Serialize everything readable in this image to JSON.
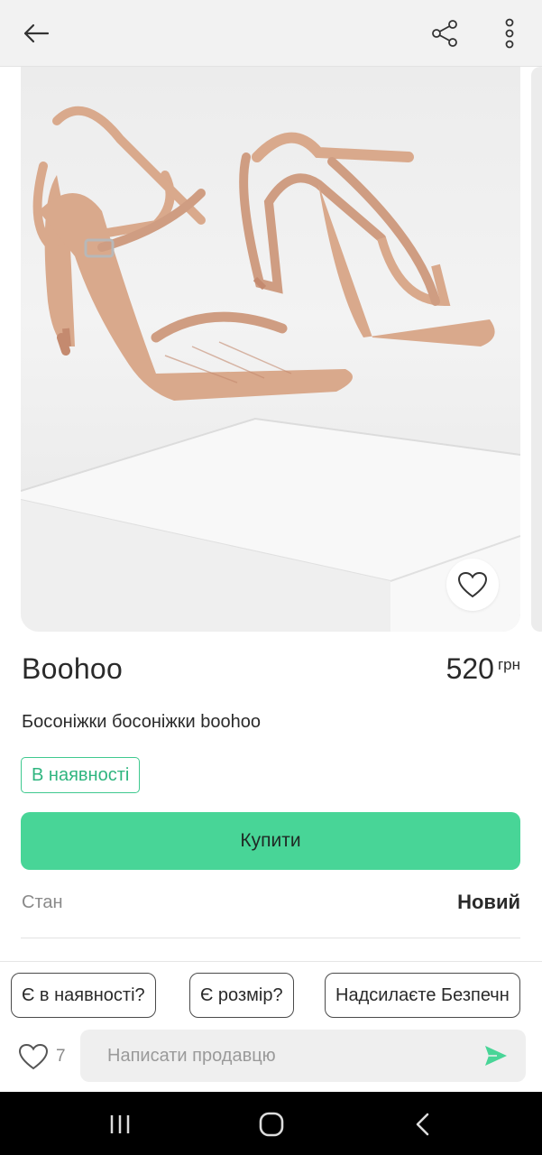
{
  "product": {
    "brand": "Boohoo",
    "price": "520",
    "currency": "грн",
    "title": "Босоніжки босоніжки boohoo",
    "stock_label": "В наявності",
    "buy_label": "Купити",
    "condition_label": "Стан",
    "condition_value": "Новий",
    "likes_count": "7"
  },
  "quick_questions": [
    "Є в наявності?",
    "Є розмір?",
    "Надсилаєте Безпечн"
  ],
  "message": {
    "placeholder": "Написати продавцю"
  },
  "colors": {
    "accent": "#48d597",
    "stock_border": "#3fc98f",
    "nude_leather": "#d9a98c"
  },
  "icons": {
    "back": "arrow-left-icon",
    "share": "share-icon",
    "more": "more-vertical-icon",
    "favorite": "heart-icon",
    "send": "send-icon",
    "nav_recents": "recents-icon",
    "nav_home": "home-icon",
    "nav_back": "chevron-left-icon"
  }
}
